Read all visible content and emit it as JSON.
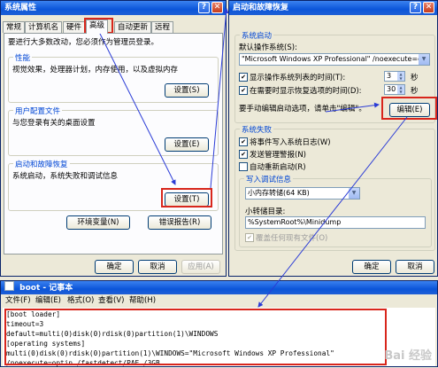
{
  "sysprops": {
    "title": "系统属性",
    "tabs": [
      "常规",
      "计算机名",
      "硬件",
      "高级",
      "自动更新",
      "远程"
    ],
    "intro": "要进行大多数改动，您必须作为管理员登录。",
    "perf": {
      "label": "性能",
      "desc": "视觉效果，处理器计划，内存使用，以及虚拟内存",
      "button": "设置(S)"
    },
    "profile": {
      "label": "用户配置文件",
      "desc": "与您登录有关的桌面设置",
      "button": "设置(E)"
    },
    "startup": {
      "label": "启动和故障恢复",
      "desc": "系统启动，系统失败和调试信息",
      "button": "设置(T)"
    },
    "env_button": "环境变量(N)",
    "error_button": "错误报告(R)",
    "ok": "确定",
    "cancel": "取消",
    "apply": "应用(A)"
  },
  "startup_dialog": {
    "title": "启动和故障恢复",
    "system_startup": "系统启动",
    "default_os_label": "默认操作系统(S):",
    "default_os_value": "\"Microsoft Windows XP Professional\" /noexecute=optin",
    "show_os_list": "显示操作系统列表的时间(T):",
    "show_os_list_value": "3",
    "show_recovery": "在需要时显示恢复选项的时间(D):",
    "show_recovery_value": "30",
    "seconds": "秒",
    "seconds2": "秒",
    "manual_edit": "要手动编辑启动选项，请单击\"编辑\"。",
    "edit_button": "编辑(E)",
    "system_failure": "系统失败",
    "write_event": "将事件写入系统日志(W)",
    "send_alert": "发送管理警报(N)",
    "auto_restart": "自动重新启动(R)",
    "debug_info": "写入调试信息",
    "debug_select": "小内存转储(64 KB)",
    "small_dump_dir": "小转储目录:",
    "dump_path": "%SystemRoot%\\Minidump",
    "overwrite": "覆盖任何现有文件(O)",
    "ok": "确定",
    "cancel": "取消"
  },
  "notepad": {
    "title": "boot - 记事本",
    "menu": [
      "文件(F)",
      "编辑(E)",
      "格式(O)",
      "查看(V)",
      "帮助(H)"
    ],
    "lines": [
      "[boot loader]",
      "timeout=3",
      "default=multi(0)disk(0)rdisk(0)partition(1)\\WINDOWS",
      "[operating systems]",
      "multi(0)disk(0)rdisk(0)partition(1)\\WINDOWS=\"Microsoft Windows XP Professional\"",
      "/noexecute=optin /fastdetect/PAE /3GB"
    ],
    "watermark": "Bai 经验"
  },
  "colors": {
    "highlight": "#d8261c",
    "arrow": "#2a3bd6",
    "titlebar": "#0b55d9"
  }
}
